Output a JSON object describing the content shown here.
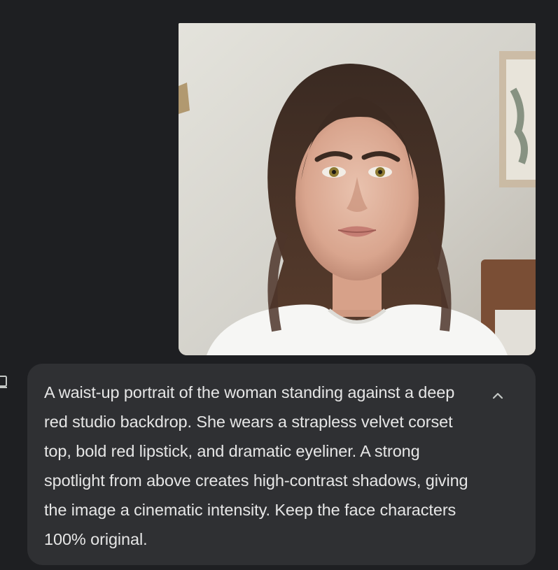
{
  "message": {
    "attachment": {
      "kind": "portrait-photo"
    },
    "prompt_text": "A waist-up portrait of the woman standing against a deep red studio backdrop. She wears a strapless velvet corset top, bold red lipstick, and dramatic eyeliner. A strong spotlight from above creates high-contrast shadows, giving the image a cinematic intensity. Keep the face characters 100% original.",
    "expand_icon": "chevron-up-icon",
    "copy_icon": "copy-icon"
  },
  "colors": {
    "background": "#1e1f22",
    "bubble": "#2f3033",
    "text": "#e6e6e6",
    "icon": "#c4c7c5"
  }
}
